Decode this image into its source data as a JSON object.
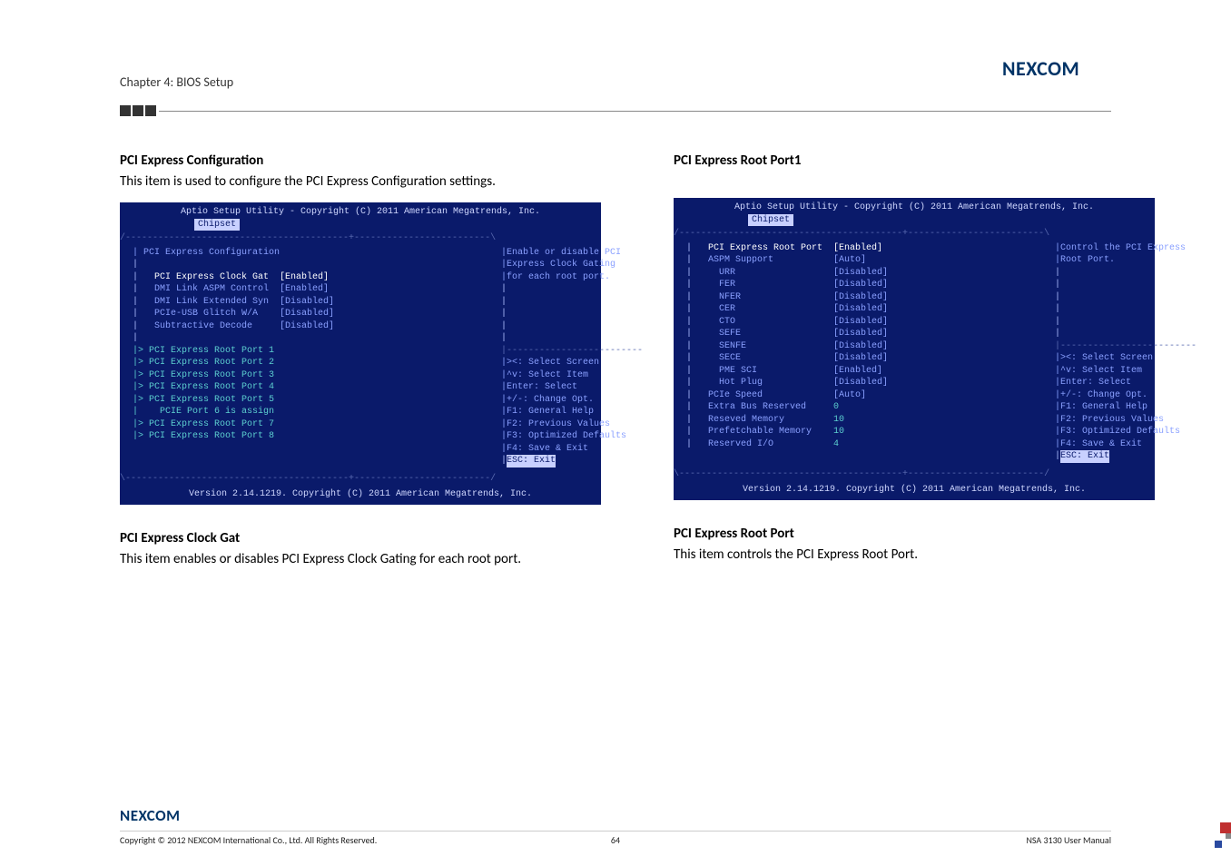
{
  "chapter_header": "Chapter 4: BIOS Setup",
  "logo_text": "NEXCOM",
  "left": {
    "heading1": "PCI Express Configuration",
    "text1": "This item is used to configure the PCI Express Configuration settings.",
    "heading2": "PCI Express Clock Gat",
    "text2": "This item enables or disables PCI Express Clock Gating for each root port."
  },
  "right": {
    "heading1": "PCI Express Root Port1",
    "heading2": "PCI Express Root Port",
    "text2": "This item controls the PCI Express Root Port."
  },
  "bios1": {
    "title": "Aptio Setup Utility - Copyright (C) 2011 American Megatrends, Inc.",
    "tab": "Chipset",
    "section": "PCI Express Configuration",
    "rows": [
      {
        "label": "PCI Express Clock Gat",
        "value": "[Enabled]",
        "selected": true
      },
      {
        "label": "DMI Link ASPM Control",
        "value": "[Enabled]"
      },
      {
        "label": "DMI Link Extended Syn",
        "value": "[Disabled]"
      },
      {
        "label": "PCIe-USB Glitch W/A",
        "value": "[Disabled]"
      },
      {
        "label": "Subtractive Decode",
        "value": "[Disabled]"
      }
    ],
    "ports": [
      "PCI Express Root Port 1",
      "PCI Express Root Port 2",
      "PCI Express Root Port 3",
      "PCI Express Root Port 4",
      "PCI Express Root Port 5",
      "  PCIE Port 6 is assign",
      "PCI Express Root Port 7",
      "PCI Express Root Port 8"
    ],
    "help": "Enable or disable PCI Express Clock Gating for each root port.",
    "nav": [
      "><: Select Screen",
      "^v: Select Item",
      "Enter: Select",
      "+/-: Change Opt.",
      "F1: General Help",
      "F2: Previous Values",
      "F3: Optimized Defaults",
      "F4: Save & Exit"
    ],
    "esc": "ESC: Exit",
    "footer": "Version 2.14.1219. Copyright (C) 2011 American Megatrends, Inc."
  },
  "bios2": {
    "title": "Aptio Setup Utility - Copyright (C) 2011 American Megatrends, Inc.",
    "tab": "Chipset",
    "rows": [
      {
        "label": "PCI Express Root Port",
        "value": "[Enabled]",
        "selected": true
      },
      {
        "label": "ASPM Support",
        "value": "[Auto]"
      },
      {
        "label": "  URR",
        "value": "[Disabled]"
      },
      {
        "label": "  FER",
        "value": "[Disabled]"
      },
      {
        "label": "  NFER",
        "value": "[Disabled]"
      },
      {
        "label": "  CER",
        "value": "[Disabled]"
      },
      {
        "label": "  CTO",
        "value": "[Disabled]"
      },
      {
        "label": "  SEFE",
        "value": "[Disabled]"
      },
      {
        "label": "  SENFE",
        "value": "[Disabled]"
      },
      {
        "label": "  SECE",
        "value": "[Disabled]"
      },
      {
        "label": "  PME SCI",
        "value": "[Enabled]"
      },
      {
        "label": "  Hot Plug",
        "value": "[Disabled]"
      },
      {
        "label": "PCIe Speed",
        "value": "[Auto]"
      },
      {
        "label": "Extra Bus Reserved",
        "value": "0",
        "teal": true
      },
      {
        "label": "Reseved Memory",
        "value": "10",
        "teal": true
      },
      {
        "label": "Prefetchable Memory",
        "value": "10",
        "teal": true
      },
      {
        "label": "Reserved I/O",
        "value": "4",
        "teal": true
      }
    ],
    "help": "Control the PCI Express Root Port.",
    "nav": [
      "><: Select Screen",
      "^v: Select Item",
      "Enter: Select",
      "+/-: Change Opt.",
      "F1: General Help",
      "F2: Previous Values",
      "F3: Optimized Defaults",
      "F4: Save & Exit"
    ],
    "esc": "ESC: Exit",
    "footer": "Version 2.14.1219. Copyright (C) 2011 American Megatrends, Inc."
  },
  "footer": {
    "left": "Copyright © 2012 NEXCOM International Co., Ltd. All Rights Reserved.",
    "center": "64",
    "right": "NSA 3130 User Manual"
  }
}
